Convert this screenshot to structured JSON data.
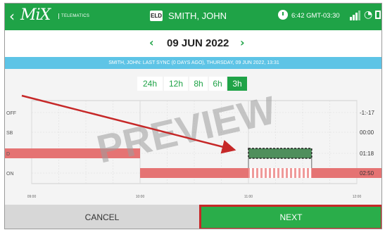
{
  "app": {
    "back_glyph": "‹",
    "logo_text": "MiX",
    "logo_subtitle": "TELEMATICS",
    "eld_badge": "ELD",
    "driver_name": "SMITH, JOHN",
    "clock_text": "6:42 GMT-03:30",
    "menu_glyph": "⋮",
    "icons": [
      "back-chevron-icon",
      "eld-icon",
      "clock-icon",
      "signal-icon",
      "wifi-icon",
      "document-icon",
      "overflow-menu-icon"
    ]
  },
  "date_nav": {
    "prev_glyph": "‹",
    "date": "09 JUN 2022",
    "next_glyph": "›"
  },
  "sync_status": "SMITH, JOHN: LAST SYNC (0 DAYS AGO), THURSDAY, 09 JUN 2022, 13:31",
  "ranges": {
    "options": [
      "24h",
      "12h",
      "8h",
      "6h",
      "3h"
    ],
    "selected": "3h"
  },
  "chart_data": {
    "type": "duty-status-log",
    "x_ticks": [
      "09:00",
      "10:00",
      "11:00",
      "12:00"
    ],
    "status_rows": [
      "OFF",
      "SB",
      "D",
      "ON"
    ],
    "totals": [
      "-1:-17",
      "00:00",
      "01:18",
      "02:50"
    ],
    "segments": [
      {
        "status": "D",
        "start": "09:00",
        "end": "10:00",
        "style": "solid"
      },
      {
        "status": "ON",
        "start": "10:00",
        "end": "12:00",
        "style": "solid"
      },
      {
        "status": "D",
        "start": "11:00",
        "end": "11:35",
        "style": "edited-selection"
      },
      {
        "status": "ON",
        "start": "11:00",
        "end": "11:35",
        "style": "striped"
      }
    ],
    "watermark": "PREVIEW",
    "colors": {
      "status_bar": "#e57373",
      "selection": "#4f8f5c",
      "annotation_arrow": "#c62828"
    }
  },
  "actions": {
    "cancel_label": "CANCEL",
    "next_label": "NEXT"
  },
  "colors": {
    "header_green": "#1fa347",
    "sync_blue": "#5ec4e6",
    "highlight_red": "#c62828"
  }
}
